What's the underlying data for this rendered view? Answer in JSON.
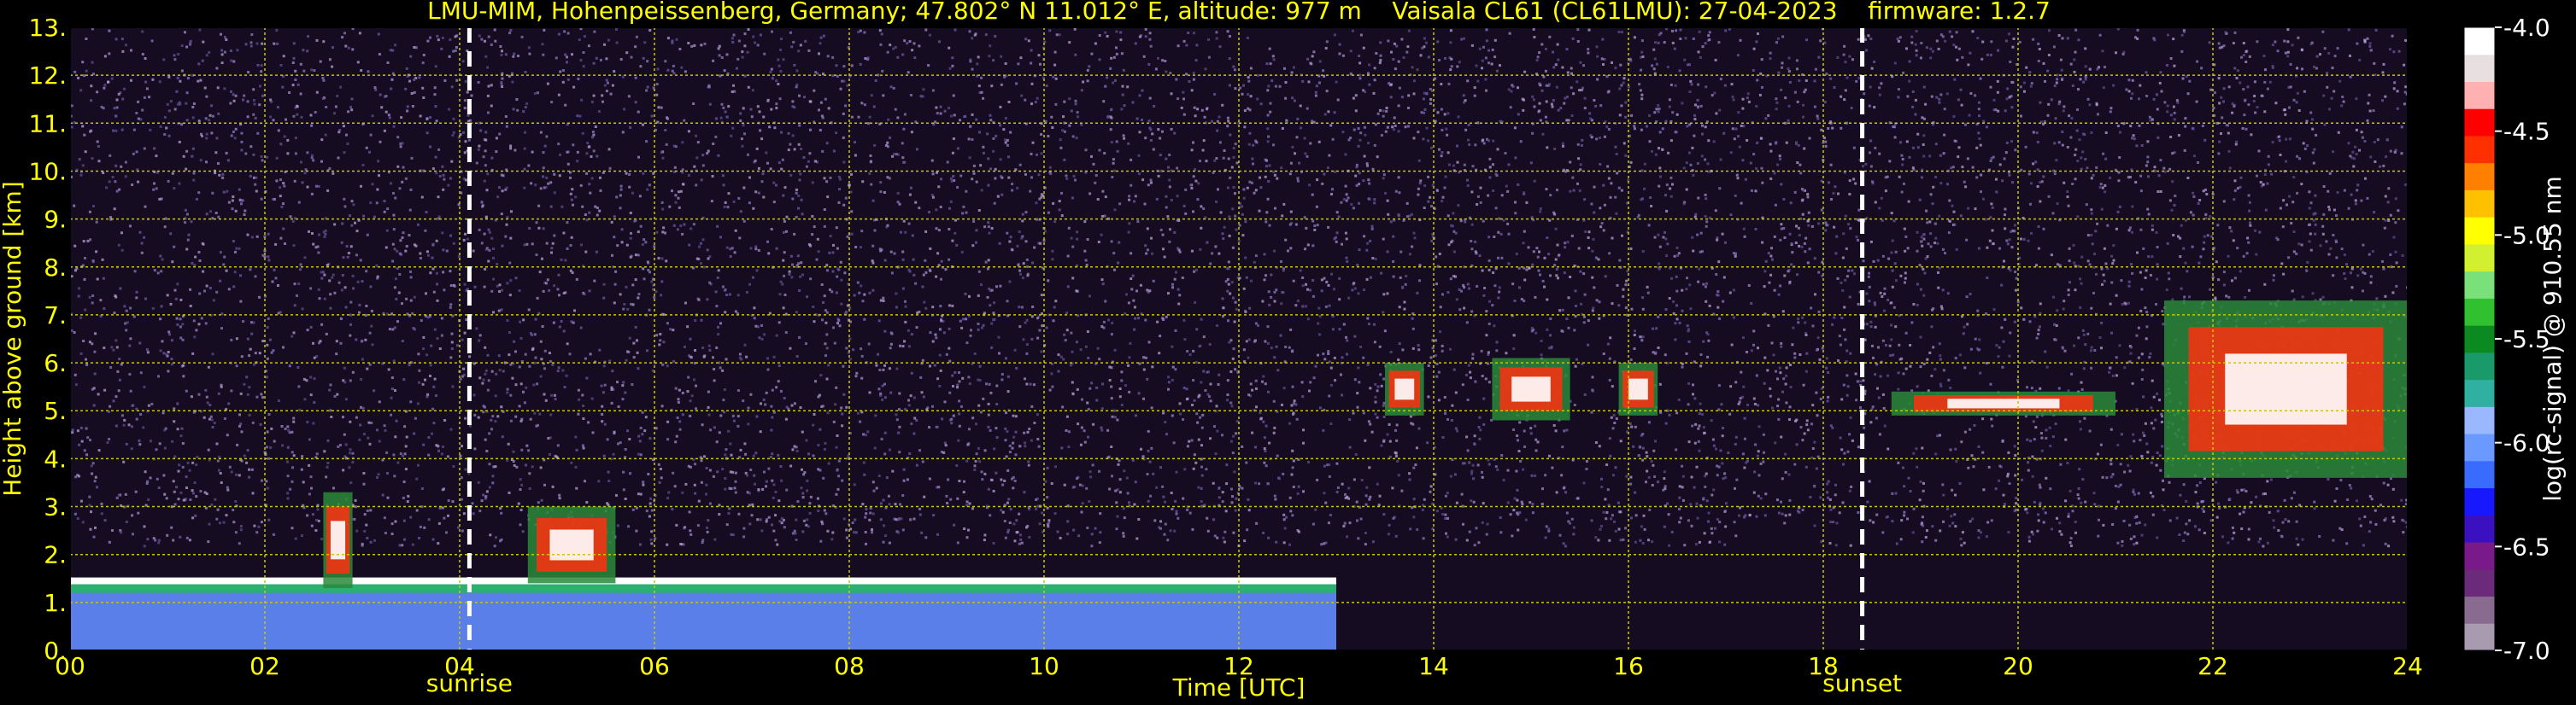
{
  "title": "LMU-MIM, Hohenpeissenberg, Germany; 47.802° N 11.012° E, altitude: 977 m    Vaisala CL61 (CL61LMU): 27-04-2023    firmware: 1.2.7",
  "colors": {
    "background": "#000000",
    "text": "#ffff00",
    "grid": "#c8c800",
    "marker": "#ffffff",
    "colorbar_text": "#ffffff",
    "noise": [
      "#8a7bbf",
      "#a58ecf",
      "#6c5aa6",
      "#b7a3d8",
      "#5e4d8c"
    ]
  },
  "chart_data": {
    "type": "heatmap",
    "title": "LMU-MIM, Hohenpeissenberg, Germany; 47.802° N 11.012° E, altitude: 977 m    Vaisala CL61 (CL61LMU): 27-04-2023    firmware: 1.2.7",
    "xlabel": "Time [UTC]",
    "ylabel": "Height above ground [km]",
    "xlim": [
      0,
      24
    ],
    "ylim": [
      0,
      13
    ],
    "xticks": [
      0,
      2,
      4,
      6,
      8,
      10,
      12,
      14,
      16,
      18,
      20,
      22,
      24
    ],
    "xtick_labels": [
      "00",
      "02",
      "04",
      "06",
      "08",
      "10",
      "12",
      "14",
      "16",
      "18",
      "20",
      "22",
      "24"
    ],
    "yticks": [
      0,
      1,
      2,
      3,
      4,
      5,
      6,
      7,
      8,
      9,
      10,
      11,
      12,
      13
    ],
    "ytick_labels": [
      "0.",
      "1.",
      "2.",
      "3.",
      "4.",
      "5.",
      "6.",
      "7.",
      "8.",
      "9.",
      "10.",
      "11.",
      "12.",
      "13."
    ],
    "grid": true,
    "markers": [
      {
        "label": "sunrise",
        "x": 4.1
      },
      {
        "label": "sunset",
        "x": 18.4
      }
    ],
    "colorbar": {
      "label": "log(rc-signal) @ 910.55 nm",
      "range": [
        -7.0,
        -4.0
      ],
      "ticks": [
        -4.0,
        -4.5,
        -5.0,
        -5.5,
        -6.0,
        -6.5,
        -7.0
      ],
      "tick_labels": [
        "-4.0",
        "-4.5",
        "-5.0",
        "-5.5",
        "-6.0",
        "-6.5",
        "-7.0"
      ],
      "colors": [
        "#a89aaf",
        "#8a6b90",
        "#6b2a7a",
        "#7a1a8a",
        "#3a10c0",
        "#1818ff",
        "#3a6bff",
        "#6a9aff",
        "#9ab8ff",
        "#30b0a0",
        "#1a9a6a",
        "#0a8a20",
        "#30c030",
        "#7ae07a",
        "#d0f030",
        "#ffff00",
        "#ffc000",
        "#ff8000",
        "#ff3000",
        "#ff0000",
        "#ffb0b0",
        "#e8e0e0",
        "#ffffff"
      ]
    },
    "features": [
      {
        "kind": "boundary_layer",
        "start": 0,
        "end": 13,
        "top": 1.45
      },
      {
        "kind": "cloud",
        "start": 2.6,
        "end": 2.9,
        "bottom": 1.3,
        "top": 3.3
      },
      {
        "kind": "cloud",
        "start": 4.7,
        "end": 5.6,
        "bottom": 1.4,
        "top": 3.0
      },
      {
        "kind": "cloud",
        "start": 13.5,
        "end": 13.9,
        "bottom": 4.9,
        "top": 6.0
      },
      {
        "kind": "cloud",
        "start": 14.6,
        "end": 15.4,
        "bottom": 4.8,
        "top": 6.1
      },
      {
        "kind": "cloud",
        "start": 15.9,
        "end": 16.3,
        "bottom": 4.9,
        "top": 6.0
      },
      {
        "kind": "cloud",
        "start": 18.7,
        "end": 21.0,
        "bottom": 4.9,
        "top": 5.4
      },
      {
        "kind": "cloud",
        "start": 21.5,
        "end": 24,
        "bottom": 3.6,
        "top": 7.3
      }
    ]
  }
}
